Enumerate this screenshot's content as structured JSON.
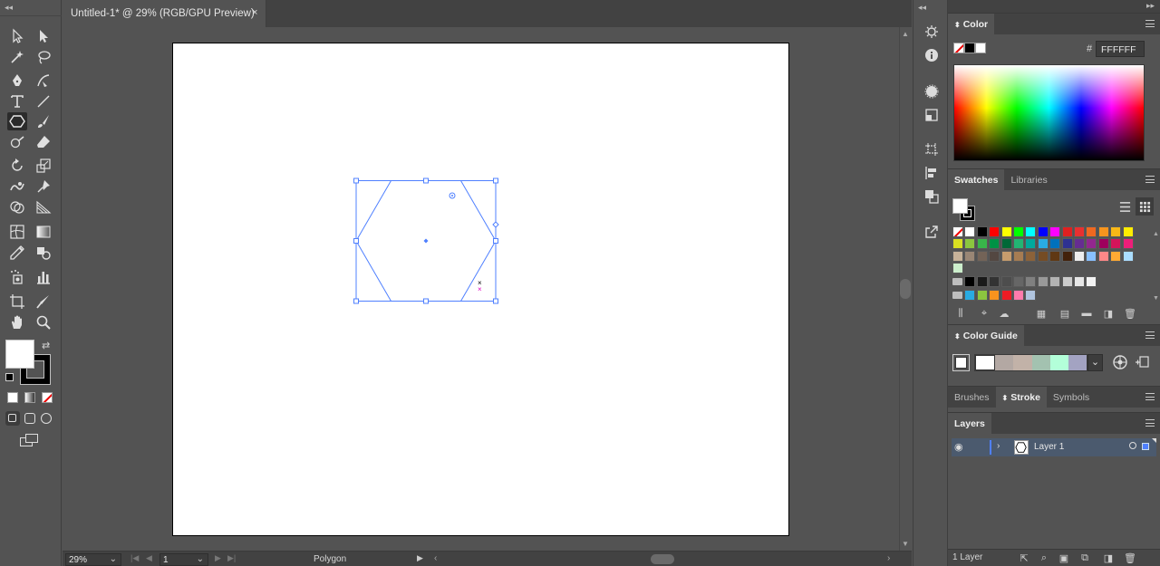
{
  "document": {
    "tab_title": "Untitled-1* @ 29% (RGB/GPU Preview)",
    "close_glyph": "×"
  },
  "toolbar": {
    "collapse_glyph": "◂◂",
    "tools": [
      {
        "name": "selection-tool",
        "icon": "arrow-icon"
      },
      {
        "name": "direct-selection-tool",
        "icon": "white-arrow-icon"
      },
      {
        "name": "magic-wand-tool",
        "icon": "magic-wand-icon"
      },
      {
        "name": "lasso-tool",
        "icon": "lasso-icon"
      },
      {
        "name": "pen-tool",
        "icon": "pen-icon"
      },
      {
        "name": "curvature-tool",
        "icon": "curvature-icon"
      },
      {
        "name": "type-tool",
        "icon": "type-icon"
      },
      {
        "name": "line-segment-tool",
        "icon": "line-icon"
      },
      {
        "name": "polygon-tool",
        "icon": "polygon-icon",
        "active": true
      },
      {
        "name": "paintbrush-tool",
        "icon": "brush-icon"
      },
      {
        "name": "shaper-tool",
        "icon": "shaper-icon"
      },
      {
        "name": "eraser-tool",
        "icon": "eraser-icon"
      },
      {
        "name": "rotate-tool",
        "icon": "rotate-icon"
      },
      {
        "name": "scale-tool",
        "icon": "scale-icon"
      },
      {
        "name": "warp-tool",
        "icon": "warp-icon"
      },
      {
        "name": "puppet-warp-tool",
        "icon": "pin-icon"
      },
      {
        "name": "shape-builder-tool",
        "icon": "shape-builder-icon"
      },
      {
        "name": "perspective-grid-tool",
        "icon": "perspective-icon"
      },
      {
        "name": "mesh-tool",
        "icon": "mesh-icon"
      },
      {
        "name": "gradient-tool",
        "icon": "gradient-icon"
      },
      {
        "name": "eyedropper-tool",
        "icon": "eyedropper-icon"
      },
      {
        "name": "blend-tool",
        "icon": "blend-icon"
      },
      {
        "name": "symbol-sprayer-tool",
        "icon": "sprayer-icon"
      },
      {
        "name": "column-graph-tool",
        "icon": "graph-icon"
      },
      {
        "name": "artboard-tool",
        "icon": "artboard-icon"
      },
      {
        "name": "slice-tool",
        "icon": "knife-icon"
      },
      {
        "name": "hand-tool",
        "icon": "hand-icon"
      },
      {
        "name": "zoom-tool",
        "icon": "zoom-icon"
      }
    ],
    "fill_color": "#ffffff",
    "stroke_color": "#000000"
  },
  "status": {
    "zoom": "29%",
    "artboard_number": "1",
    "selection_label": "Polygon"
  },
  "color_panel": {
    "title": "Color",
    "hex_symbol": "#",
    "hex_value": "FFFFFF"
  },
  "swatches_panel": {
    "tab_swatches": "Swatches",
    "tab_libraries": "Libraries",
    "rows": [
      [
        "none",
        "#ffffff",
        "#000000",
        "#ff0000",
        "#ffff00",
        "#00ff00",
        "#00ffff",
        "#0000ff",
        "#ff00ff",
        "#e02020",
        "#e83030",
        "#f06820",
        "#f7941d",
        "#f8b817",
        "#ffed00"
      ],
      [
        "#d9e021",
        "#8cc63f",
        "#39b54a",
        "#009245",
        "#006837",
        "#22b573",
        "#00a99d",
        "#29abe2",
        "#0071bc",
        "#2e3192",
        "#662d91",
        "#93278f",
        "#9e005d",
        "#d4145a",
        "#ed1e79"
      ],
      [
        "#c7b299",
        "#998675",
        "#736357",
        "#534741",
        "#c69c6d",
        "#a67c52",
        "#8c6239",
        "#754c24",
        "#603813",
        "#42210b",
        "#eeeeee",
        "#88c0ff",
        "#ff8888",
        "#ffaa33",
        "#aaddff"
      ],
      [
        "#cceecc"
      ]
    ],
    "gray_row": [
      "#000000",
      "#1a1a1a",
      "#333333",
      "#4d4d4d",
      "#666666",
      "#808080",
      "#999999",
      "#b3b3b3",
      "#cccccc",
      "#e6e6e6",
      "#f2f2f2"
    ],
    "color_group_row": [
      "#29abe2",
      "#8cc63f",
      "#f7931e",
      "#ed1c24",
      "#ff7bac",
      "#b0c4de"
    ]
  },
  "color_guide_panel": {
    "title": "Color Guide",
    "harmony": [
      "#ffffff",
      "#b3a8a3",
      "#c2b2a8",
      "#a3c2b0",
      "#b3ffd9",
      "#a3a3c2"
    ]
  },
  "stroke_group": {
    "tab_brushes": "Brushes",
    "tab_stroke": "Stroke",
    "tab_symbols": "Symbols"
  },
  "layers_panel": {
    "title": "Layers",
    "layers": [
      {
        "name": "Layer 1",
        "color": "#4f80ff"
      }
    ],
    "footer_count": "1 Layer"
  }
}
